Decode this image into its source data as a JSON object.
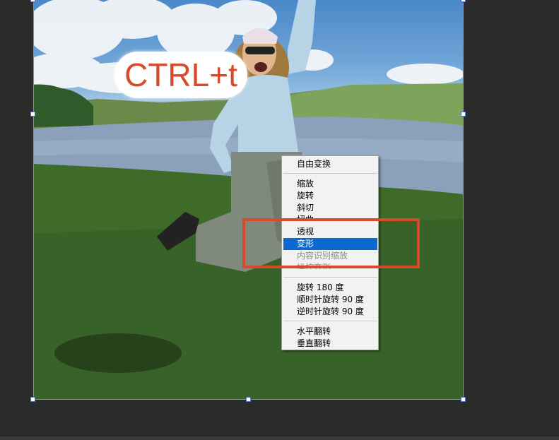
{
  "hint": {
    "text": "CTRL+t"
  },
  "menu": {
    "free_transform": "自由变换",
    "scale": "缩放",
    "rotate": "旋转",
    "skew": "斜切",
    "distort": "扭曲",
    "perspective": "透视",
    "warp": "变形",
    "content_aware_scale": "内容识别缩放",
    "puppet_warp": "操控变形",
    "rotate_180": "旋转 180 度",
    "rotate_90_cw": "顺时针旋转 90 度",
    "rotate_90_ccw": "逆时针旋转 90 度",
    "flip_horizontal": "水平翻转",
    "flip_vertical": "垂直翻转"
  },
  "colors": {
    "background": "#2b2b2b",
    "selection": "#0a6ad0",
    "annotation": "#d94a2b",
    "bbox": "#6c8fd8"
  }
}
